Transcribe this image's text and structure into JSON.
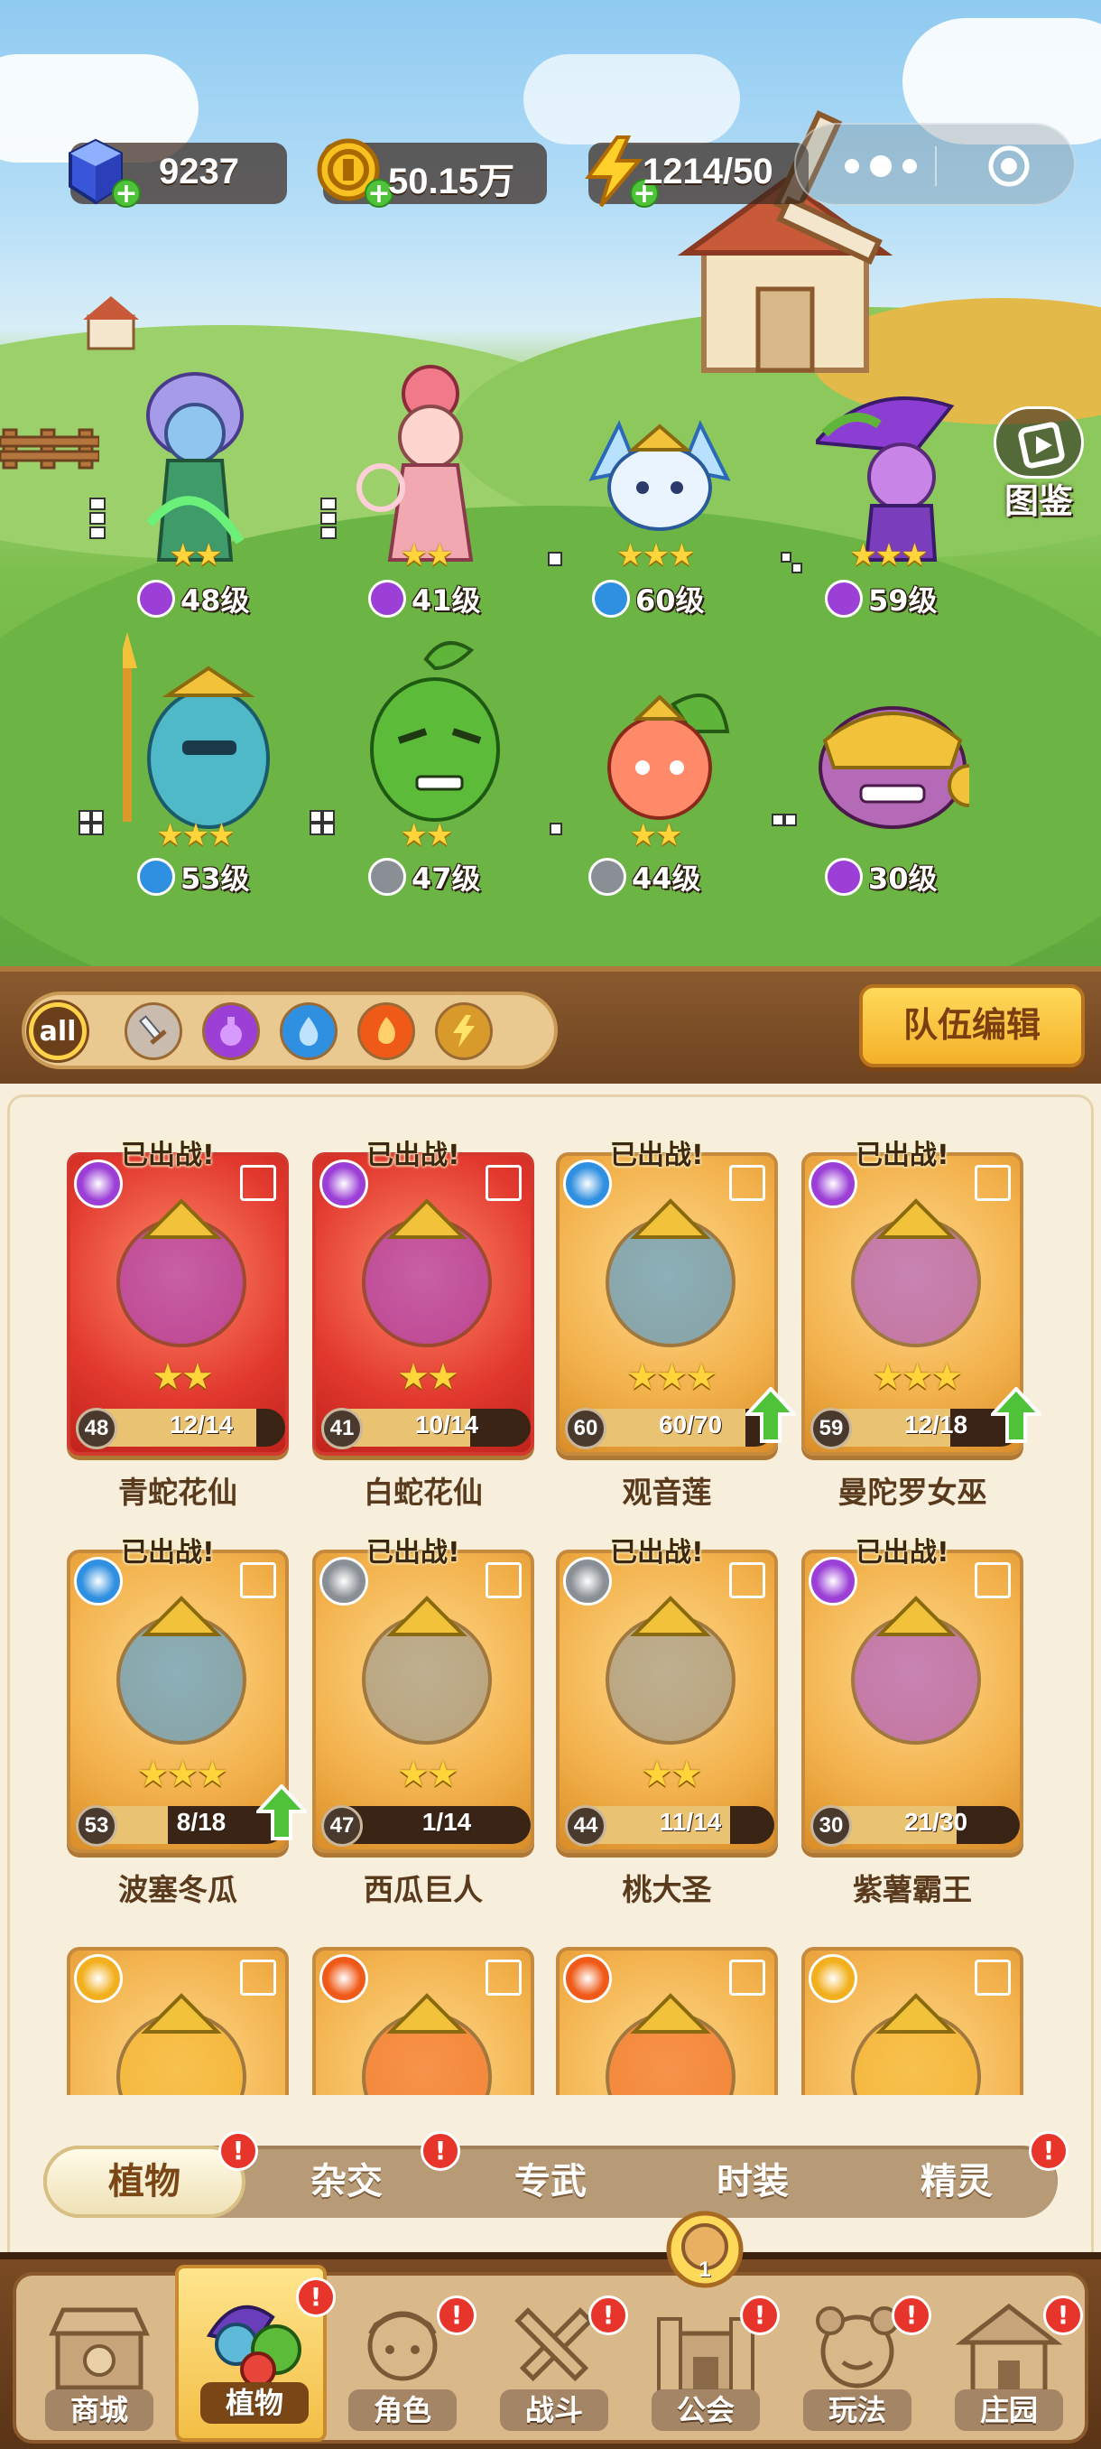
{
  "resources": {
    "gems": "9237",
    "gold": "50.15万",
    "energy": "1214/50"
  },
  "codex_label": "图鉴",
  "heroes_field": [
    {
      "stars": "★★",
      "level": "48级",
      "element": "poison"
    },
    {
      "stars": "★★",
      "level": "41级",
      "element": "poison"
    },
    {
      "stars": "★★★",
      "level": "60级",
      "element": "water"
    },
    {
      "stars": "★★★",
      "level": "59级",
      "element": "poison"
    },
    {
      "stars": "★★★",
      "level": "53级",
      "element": "water"
    },
    {
      "stars": "★★",
      "level": "47级",
      "element": "sword"
    },
    {
      "stars": "★★",
      "level": "44级",
      "element": "sword"
    },
    {
      "stars": "",
      "level": "30级",
      "element": "poison"
    }
  ],
  "filters": [
    "all",
    "sword-icon",
    "poison-icon",
    "water-icon",
    "fire-icon",
    "lightning-icon"
  ],
  "team_edit_label": "队伍编辑",
  "deployed_label": "已出战!",
  "cards": [
    {
      "name": "青蛇花仙",
      "level": "48",
      "fragments": "12/14",
      "progress": 0.857,
      "stars": "★★",
      "style": "red",
      "element": "poison",
      "deployed": true,
      "upgrade": false
    },
    {
      "name": "白蛇花仙",
      "level": "41",
      "fragments": "10/14",
      "progress": 0.714,
      "stars": "★★",
      "style": "red",
      "element": "poison",
      "deployed": true,
      "upgrade": false
    },
    {
      "name": "观音莲",
      "level": "60",
      "fragments": "60/70",
      "progress": 0.857,
      "stars": "★★★",
      "style": "gold",
      "element": "water",
      "deployed": true,
      "upgrade": true
    },
    {
      "name": "曼陀罗女巫",
      "level": "59",
      "fragments": "12/18",
      "progress": 0.667,
      "stars": "★★★",
      "style": "gold",
      "element": "poison",
      "deployed": true,
      "upgrade": true
    },
    {
      "name": "波塞冬瓜",
      "level": "53",
      "fragments": "8/18",
      "progress": 0.444,
      "stars": "★★★",
      "style": "gold",
      "element": "water",
      "deployed": true,
      "upgrade": true
    },
    {
      "name": "西瓜巨人",
      "level": "47",
      "fragments": "1/14",
      "progress": 0.071,
      "stars": "★★",
      "style": "gold",
      "element": "sword",
      "deployed": true,
      "upgrade": false
    },
    {
      "name": "桃大圣",
      "level": "44",
      "fragments": "11/14",
      "progress": 0.786,
      "stars": "★★",
      "style": "gold",
      "element": "sword",
      "deployed": true,
      "upgrade": false
    },
    {
      "name": "紫薯霸王",
      "level": "30",
      "fragments": "21/30",
      "progress": 0.7,
      "stars": "",
      "style": "gold",
      "element": "poison",
      "deployed": true,
      "upgrade": false
    },
    {
      "name": "",
      "level": "",
      "fragments": "",
      "progress": 0,
      "stars": "",
      "style": "gold",
      "element": "lightning",
      "deployed": false,
      "upgrade": false
    },
    {
      "name": "",
      "level": "",
      "fragments": "",
      "progress": 0,
      "stars": "",
      "style": "gold",
      "element": "fire",
      "deployed": false,
      "upgrade": false
    },
    {
      "name": "",
      "level": "",
      "fragments": "",
      "progress": 0,
      "stars": "",
      "style": "gold",
      "element": "fire",
      "deployed": false,
      "upgrade": false
    },
    {
      "name": "",
      "level": "",
      "fragments": "",
      "progress": 0,
      "stars": "",
      "style": "gold",
      "element": "lightning",
      "deployed": false,
      "upgrade": false
    }
  ],
  "tabs": [
    {
      "label": "植物",
      "alert": "!"
    },
    {
      "label": "杂交",
      "alert": "!"
    },
    {
      "label": "专武",
      "alert": ""
    },
    {
      "label": "时装",
      "alert": ""
    },
    {
      "label": "精灵",
      "alert": "!"
    }
  ],
  "bottom_nav": [
    {
      "label": "商城",
      "alert": ""
    },
    {
      "label": "植物",
      "alert": "!"
    },
    {
      "label": "角色",
      "alert": "!"
    },
    {
      "label": "战斗",
      "alert": "!"
    },
    {
      "label": "公会",
      "alert": "!"
    },
    {
      "label": "玩法",
      "alert": "!"
    },
    {
      "label": "庄园",
      "alert": "!"
    }
  ],
  "guild_badge_count": "1",
  "colors": {
    "poison": "#9b3fd6",
    "water": "#2f8fe0",
    "sword": "#8a8f96",
    "fire": "#f05a18",
    "lightning": "#f2b01e"
  }
}
